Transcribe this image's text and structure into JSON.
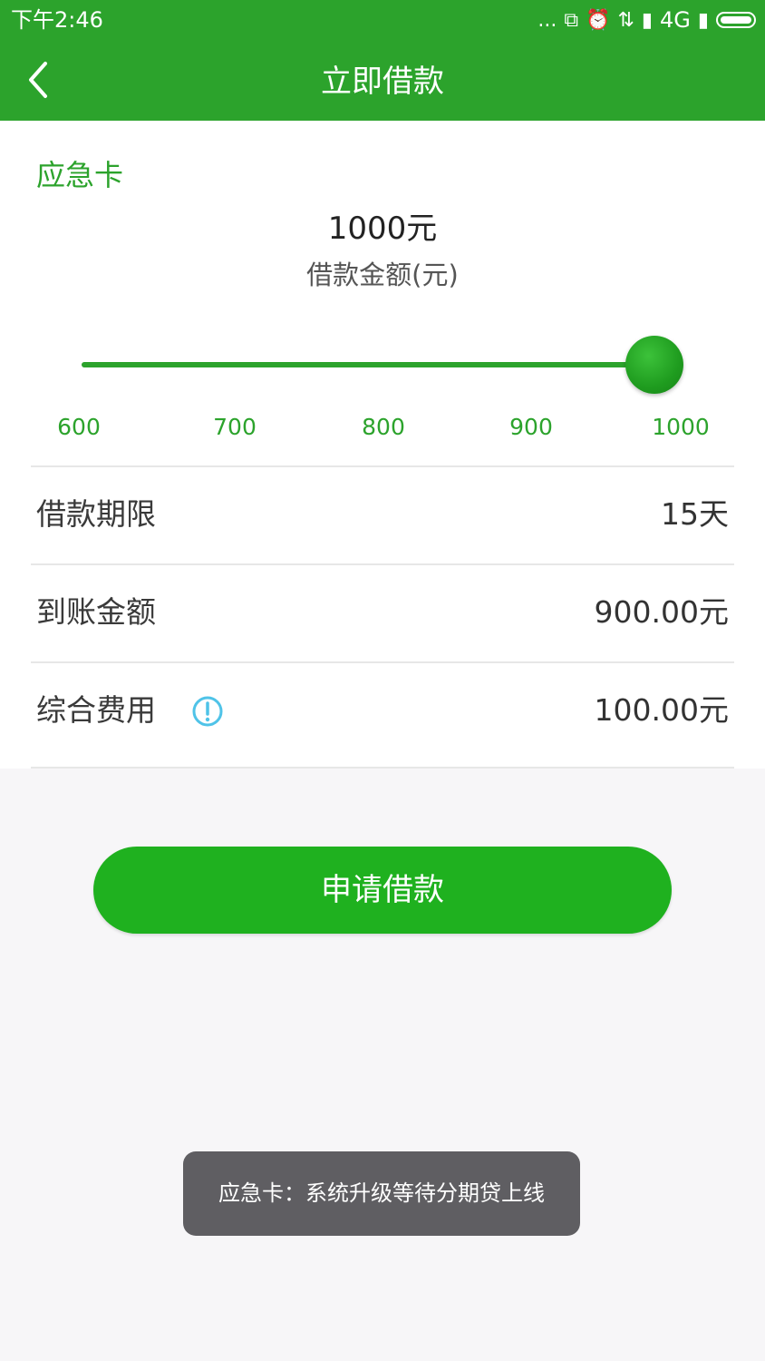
{
  "status_bar": {
    "time": "下午2:46",
    "dots": "...",
    "network_label": "4G",
    "icons": [
      "screen-mirror-icon",
      "alarm-icon",
      "data-transfer-icon",
      "signal-icon",
      "signal-icon",
      "battery-icon"
    ]
  },
  "header": {
    "title": "立即借款",
    "back_icon": "chevron-left-icon"
  },
  "loan": {
    "section_label": "应急卡",
    "amount_value": "1000元",
    "amount_caption": "借款金额(元)",
    "slider": {
      "min": 600,
      "max": 1000,
      "value": 1000,
      "ticks": [
        "600",
        "700",
        "800",
        "900",
        "1000"
      ]
    }
  },
  "details": [
    {
      "label": "借款期限",
      "value": "15天"
    },
    {
      "label": "到账金额",
      "value": "900.00元"
    },
    {
      "label": "综合费用",
      "value": "100.00元",
      "icon": "info-icon"
    }
  ],
  "apply_button": "申请借款",
  "toast": "应急卡：系统升级等待分期贷上线",
  "colors": {
    "brand_green": "#2ca32c",
    "button_green": "#1fb11f",
    "info_blue": "#4fc3e8",
    "toast_bg": "#5f5e62"
  }
}
